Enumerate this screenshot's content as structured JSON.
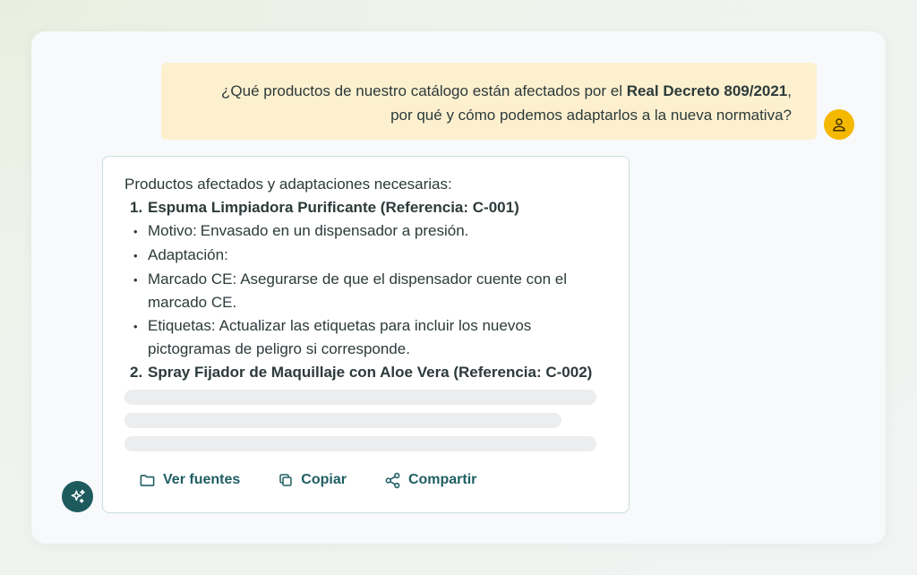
{
  "user_message": {
    "line1_prefix": "¿Qué productos de nuestro catálogo están afectados por el ",
    "line1_bold": "Real Decreto 809/2021",
    "line1_suffix": ",",
    "line2": "por qué y cómo podemos adaptarlos a la nueva normativa?"
  },
  "answer": {
    "intro": "Productos afectados y adaptaciones necesarias:",
    "items": [
      {
        "number": "1.",
        "title": "Espuma Limpiadora Purificante (Referencia: C-001)",
        "bullets": [
          {
            "key": "Motivo:",
            "text": "Envasado en un dispensador a presión."
          },
          {
            "key": "Adaptación:",
            "text": ""
          },
          {
            "key": "Marcado CE:",
            "text": "Asegurarse de que el dispensador cuente con el marcado CE."
          },
          {
            "key": "Etiquetas:",
            "text": "Actualizar las etiquetas para incluir los nuevos pictogramas de peligro si corresponde."
          }
        ]
      },
      {
        "number": "2.",
        "title": "Spray Fijador de Maquillaje con Aloe Vera (Referencia: C-002)"
      }
    ]
  },
  "actions": {
    "sources": "Ver fuentes",
    "copy": "Copiar",
    "share": "Compartir"
  },
  "colors": {
    "accent": "#1f5e63",
    "user_bubble": "#fdf0cf",
    "avatar": "#f5b800"
  }
}
